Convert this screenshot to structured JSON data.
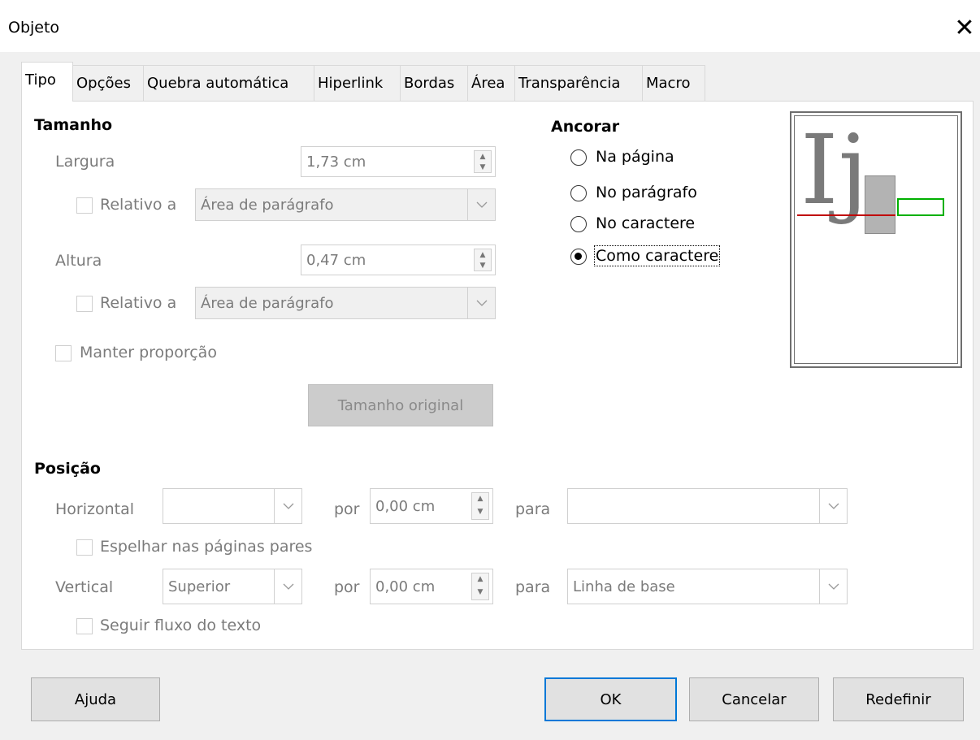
{
  "window": {
    "title": "Objeto",
    "close_icon": "close-icon"
  },
  "tabs": [
    "Tipo",
    "Opções",
    "Quebra automática",
    "Hiperlink",
    "Bordas",
    "Área",
    "Transparência",
    "Macro"
  ],
  "active_tab": "Tipo",
  "tamanho": {
    "heading": "Tamanho",
    "largura": {
      "label": "Largura",
      "value": "1,73 cm"
    },
    "largura_relativo": {
      "label": "Relativo a",
      "value": "Área de parágrafo",
      "checked": false
    },
    "altura": {
      "label": "Altura",
      "value": "0,47 cm"
    },
    "altura_relativo": {
      "label": "Relativo a",
      "value": "Área de parágrafo",
      "checked": false
    },
    "manter": {
      "label": "Manter proporção",
      "checked": false
    },
    "original_button": "Tamanho original"
  },
  "ancorar": {
    "heading": "Ancorar",
    "options": [
      "Na página",
      "No parágrafo",
      "No caractere",
      "Como caractere"
    ],
    "selected": "Como caractere"
  },
  "preview": {
    "glyphs": "Ij",
    "baseline_color": "#c00000",
    "frame_color": "#00b000"
  },
  "posicao": {
    "heading": "Posição",
    "horizontal": {
      "label": "Horizontal",
      "value": "",
      "por_label": "por",
      "por_value": "0,00 cm",
      "para_label": "para",
      "para_value": ""
    },
    "espelhar": {
      "label": "Espelhar nas páginas pares",
      "checked": false
    },
    "vertical": {
      "label": "Vertical",
      "value": "Superior",
      "por_label": "por",
      "por_value": "0,00 cm",
      "para_label": "para",
      "para_value": "Linha de base"
    },
    "seguir": {
      "label": "Seguir fluxo do texto",
      "checked": false
    }
  },
  "buttons": {
    "help": "Ajuda",
    "ok": "OK",
    "cancel": "Cancelar",
    "reset": "Redefinir"
  }
}
